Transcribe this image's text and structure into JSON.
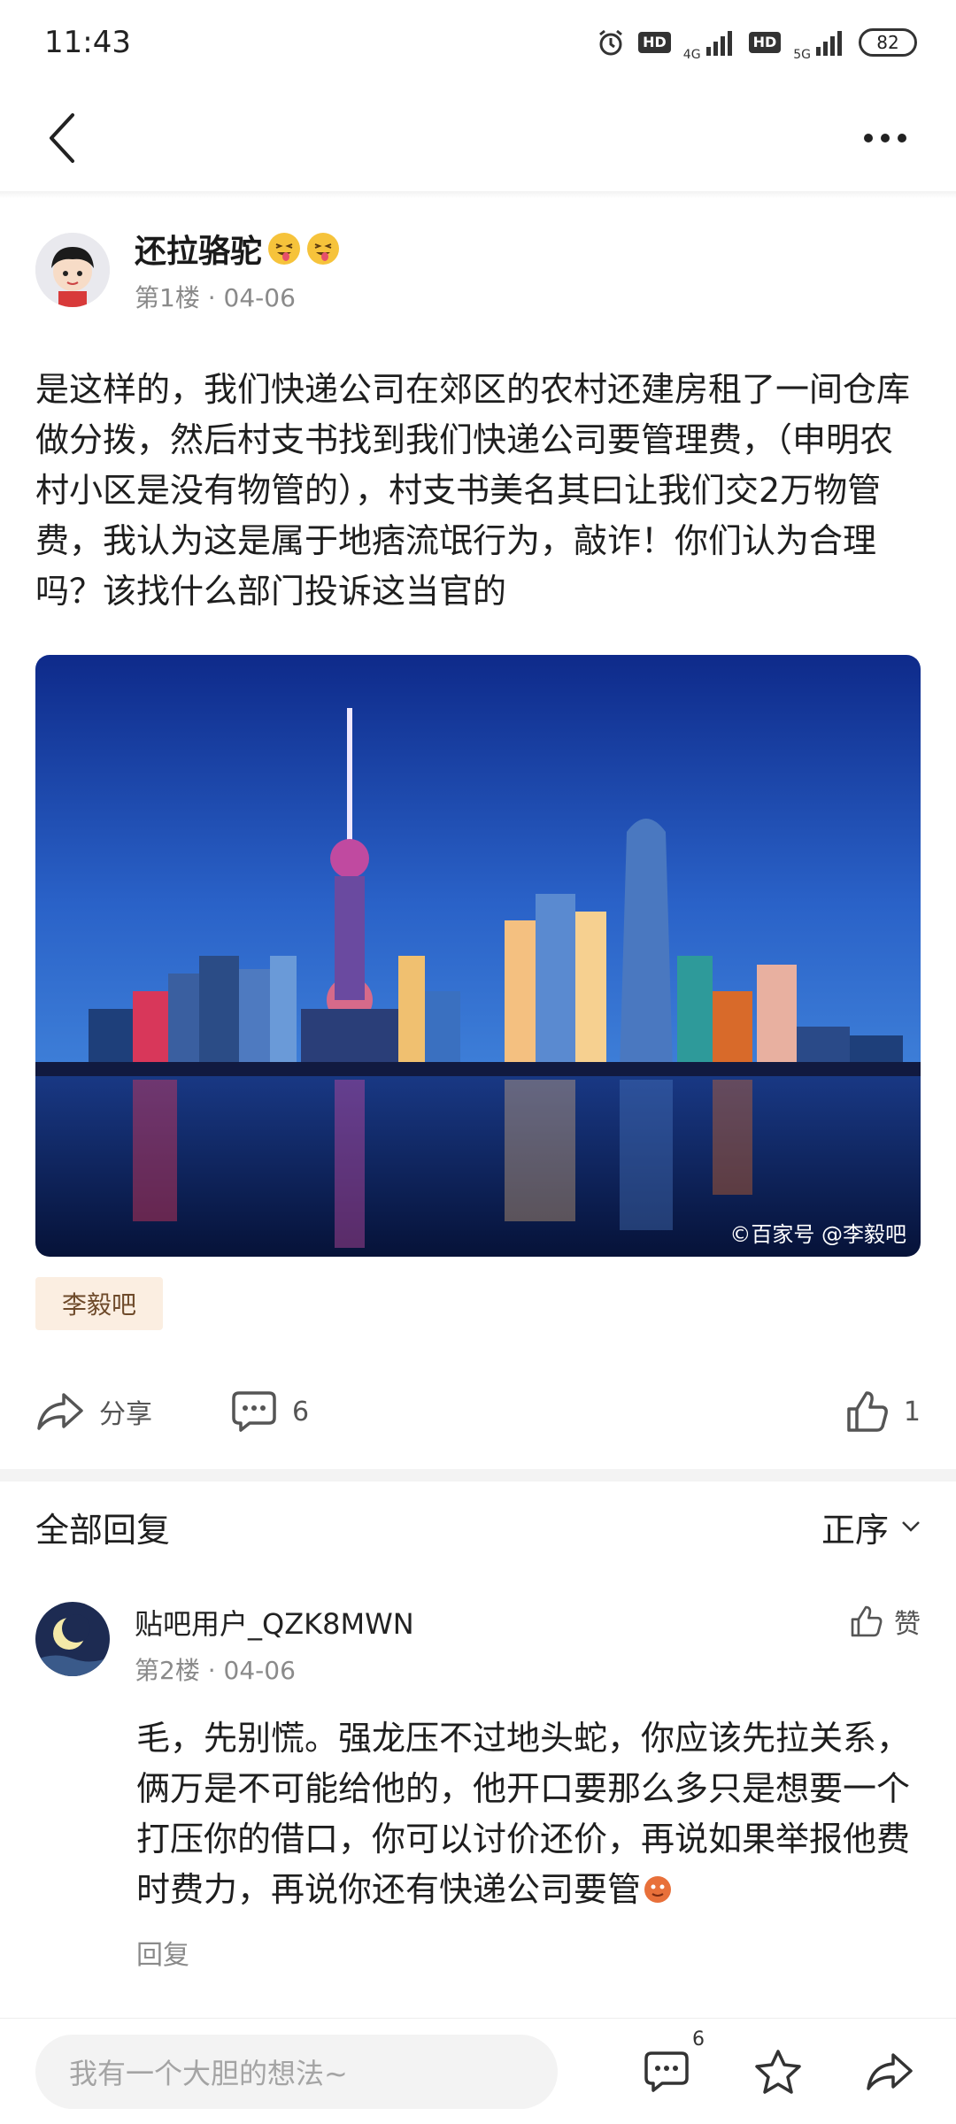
{
  "status_bar": {
    "time": "11:43",
    "net1": "4G",
    "net2": "5G",
    "hd": "HD",
    "battery": "82"
  },
  "nav": {
    "back_icon": "chevron-left-icon",
    "more_icon": "more-dots-icon"
  },
  "post": {
    "author": "还拉骆驼",
    "floor_date": "第1楼 · 04-06",
    "text": "是这样的，我们快递公司在郊区的农村还建房租了一间仓库做分拨，然后村支书找到我们快递公司要管理费，（申明农村小区是没有物管的），村支书美名其曰让我们交2万物管费，我认为这是属于地痞流氓行为，敲诈！你们认为合理吗？该找什么部门投诉这当官的",
    "image_watermark": "©百家号 @李毅吧",
    "forum_tag": "李毅吧",
    "share_label": "分享",
    "comment_count": "6",
    "like_count": "1"
  },
  "replies": {
    "title": "全部回复",
    "sort_label": "正序",
    "items": [
      {
        "user": "贴吧用户_QZK8MWN",
        "floor_date": "第2楼 · 04-06",
        "like_label": "赞",
        "text": "毛，先别慌。强龙压不过地头蛇，你应该先拉关系，俩万是不可能给他的，他开口要那么多只是想要一个打压你的借口，你可以讨价还价，再说如果举报他费时费力，再说你还有快递公司要管",
        "reply_label": "回复"
      }
    ]
  },
  "bottom_bar": {
    "input_placeholder": "我有一个大胆的想法~",
    "comment_badge": "6"
  },
  "colors": {
    "accent_tag_bg": "#fbeee1",
    "text": "#1e1e1e",
    "muted": "#8a8a8a"
  }
}
